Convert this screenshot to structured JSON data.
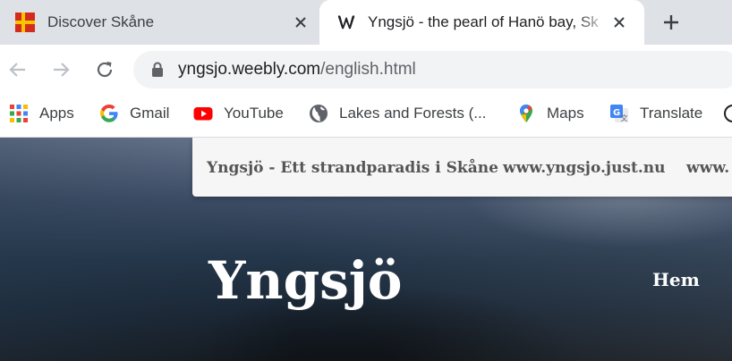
{
  "tabs": [
    {
      "title": "Discover Skåne",
      "favicon": "skane-flag-icon",
      "active": false
    },
    {
      "title": "Yngsjö - the pearl of Hanö bay, Sk",
      "favicon": "weebly-w-icon",
      "active": true
    }
  ],
  "toolbar": {
    "url_host": "yngsjo.weebly.com",
    "url_path": "/english.html"
  },
  "bookmarks": [
    {
      "label": "Apps",
      "icon": "apps-grid-icon"
    },
    {
      "label": "Gmail",
      "icon": "google-g-icon"
    },
    {
      "label": "YouTube",
      "icon": "youtube-icon"
    },
    {
      "label": "Lakes and Forests (...",
      "icon": "globe-icon"
    },
    {
      "label": "Maps",
      "icon": "maps-pin-icon"
    },
    {
      "label": "Translate",
      "icon": "translate-icon"
    }
  ],
  "site": {
    "nav_links": [
      "Yngsjö - Ett strandparadis i Skåne",
      "www.yngsjo.just.nu",
      "www."
    ],
    "title": "Yngsjö",
    "menu_item": "Hem"
  },
  "colors": {
    "tabstrip": "#dee1e6",
    "omnibox": "#f1f3f4",
    "site_nav": "#f6f6f6"
  }
}
